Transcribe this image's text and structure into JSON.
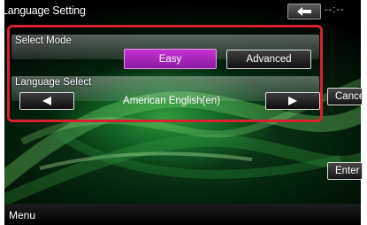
{
  "header": {
    "title": "Language Setting",
    "clock": "--:--"
  },
  "select_mode": {
    "label": "Select Mode",
    "options": [
      "Easy",
      "Advanced"
    ],
    "selected": "Easy"
  },
  "language_select": {
    "label": "Language Select",
    "value": "American English(en)"
  },
  "side_buttons": {
    "cancel": "Cancel",
    "enter": "Enter"
  },
  "footer": {
    "menu": "Menu"
  },
  "icons": {
    "back": "back-arrow-icon",
    "prev": "left-triangle-icon",
    "next": "right-triangle-icon"
  },
  "colors": {
    "highlight": "#d8202f",
    "selected_button": "#b02ac2",
    "background": "#0d4a1e"
  }
}
